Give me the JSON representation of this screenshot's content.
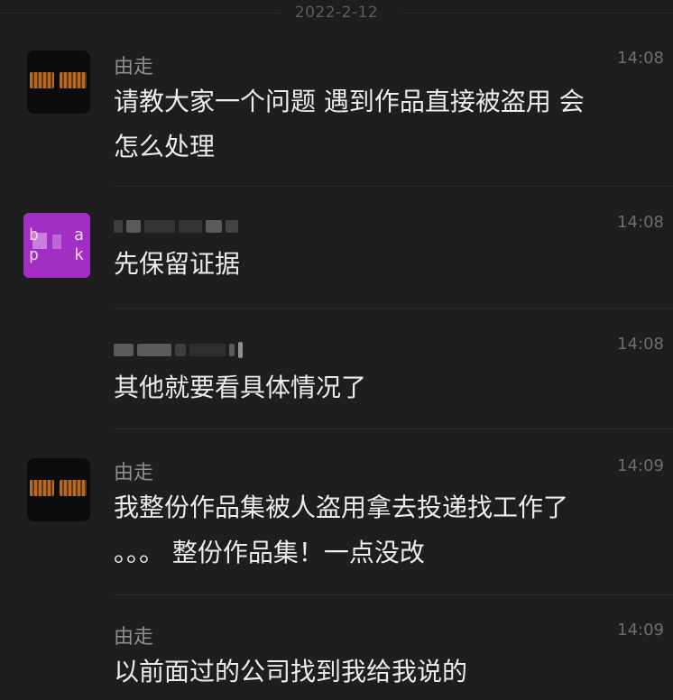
{
  "chat": {
    "date": "2022-2-12",
    "messages": [
      {
        "sender": "由走",
        "time": "14:08",
        "text": "请教大家一个问题 遇到作品直接被盗用 会\n怎么处理"
      },
      {
        "sender": "",
        "time": "14:08",
        "text": "先保留证据"
      },
      {
        "sender": "",
        "time": "14:08",
        "text": "其他就要看具体情况了"
      },
      {
        "sender": "由走",
        "time": "14:09",
        "text": "我整份作品集被人盗用拿去投递找工作了\n。。。 整份作品集！一点没改"
      },
      {
        "sender": "由走",
        "time": "14:09",
        "text": "以前面过的公司找到我给我说的"
      }
    ]
  },
  "icons": {
    "avatar_1": "dark-avatar-icon",
    "avatar_2": "purple-avatar-icon"
  },
  "colors": {
    "background": "#1e1e1f",
    "text": "#ececec",
    "meta": "#8f8f91",
    "accent_purple": "#a22fc3"
  }
}
